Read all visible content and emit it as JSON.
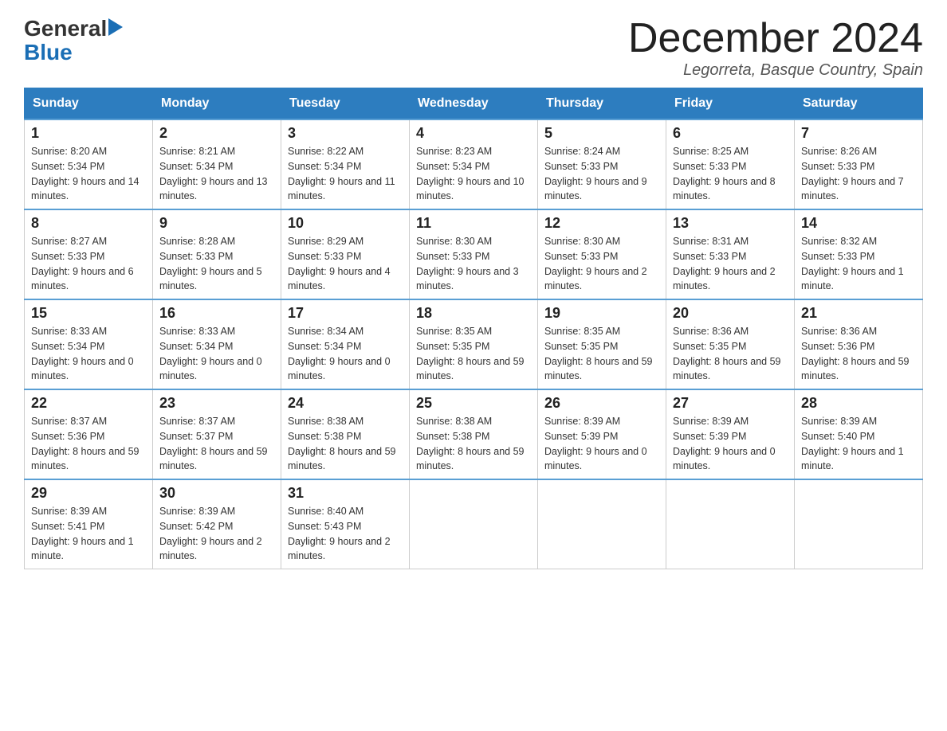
{
  "header": {
    "month_title": "December 2024",
    "location": "Legorreta, Basque Country, Spain",
    "logo_general": "General",
    "logo_blue": "Blue"
  },
  "weekdays": [
    "Sunday",
    "Monday",
    "Tuesday",
    "Wednesday",
    "Thursday",
    "Friday",
    "Saturday"
  ],
  "weeks": [
    [
      {
        "day": "1",
        "sunrise": "8:20 AM",
        "sunset": "5:34 PM",
        "daylight": "9 hours and 14 minutes."
      },
      {
        "day": "2",
        "sunrise": "8:21 AM",
        "sunset": "5:34 PM",
        "daylight": "9 hours and 13 minutes."
      },
      {
        "day": "3",
        "sunrise": "8:22 AM",
        "sunset": "5:34 PM",
        "daylight": "9 hours and 11 minutes."
      },
      {
        "day": "4",
        "sunrise": "8:23 AM",
        "sunset": "5:34 PM",
        "daylight": "9 hours and 10 minutes."
      },
      {
        "day": "5",
        "sunrise": "8:24 AM",
        "sunset": "5:33 PM",
        "daylight": "9 hours and 9 minutes."
      },
      {
        "day": "6",
        "sunrise": "8:25 AM",
        "sunset": "5:33 PM",
        "daylight": "9 hours and 8 minutes."
      },
      {
        "day": "7",
        "sunrise": "8:26 AM",
        "sunset": "5:33 PM",
        "daylight": "9 hours and 7 minutes."
      }
    ],
    [
      {
        "day": "8",
        "sunrise": "8:27 AM",
        "sunset": "5:33 PM",
        "daylight": "9 hours and 6 minutes."
      },
      {
        "day": "9",
        "sunrise": "8:28 AM",
        "sunset": "5:33 PM",
        "daylight": "9 hours and 5 minutes."
      },
      {
        "day": "10",
        "sunrise": "8:29 AM",
        "sunset": "5:33 PM",
        "daylight": "9 hours and 4 minutes."
      },
      {
        "day": "11",
        "sunrise": "8:30 AM",
        "sunset": "5:33 PM",
        "daylight": "9 hours and 3 minutes."
      },
      {
        "day": "12",
        "sunrise": "8:30 AM",
        "sunset": "5:33 PM",
        "daylight": "9 hours and 2 minutes."
      },
      {
        "day": "13",
        "sunrise": "8:31 AM",
        "sunset": "5:33 PM",
        "daylight": "9 hours and 2 minutes."
      },
      {
        "day": "14",
        "sunrise": "8:32 AM",
        "sunset": "5:33 PM",
        "daylight": "9 hours and 1 minute."
      }
    ],
    [
      {
        "day": "15",
        "sunrise": "8:33 AM",
        "sunset": "5:34 PM",
        "daylight": "9 hours and 0 minutes."
      },
      {
        "day": "16",
        "sunrise": "8:33 AM",
        "sunset": "5:34 PM",
        "daylight": "9 hours and 0 minutes."
      },
      {
        "day": "17",
        "sunrise": "8:34 AM",
        "sunset": "5:34 PM",
        "daylight": "9 hours and 0 minutes."
      },
      {
        "day": "18",
        "sunrise": "8:35 AM",
        "sunset": "5:35 PM",
        "daylight": "8 hours and 59 minutes."
      },
      {
        "day": "19",
        "sunrise": "8:35 AM",
        "sunset": "5:35 PM",
        "daylight": "8 hours and 59 minutes."
      },
      {
        "day": "20",
        "sunrise": "8:36 AM",
        "sunset": "5:35 PM",
        "daylight": "8 hours and 59 minutes."
      },
      {
        "day": "21",
        "sunrise": "8:36 AM",
        "sunset": "5:36 PM",
        "daylight": "8 hours and 59 minutes."
      }
    ],
    [
      {
        "day": "22",
        "sunrise": "8:37 AM",
        "sunset": "5:36 PM",
        "daylight": "8 hours and 59 minutes."
      },
      {
        "day": "23",
        "sunrise": "8:37 AM",
        "sunset": "5:37 PM",
        "daylight": "8 hours and 59 minutes."
      },
      {
        "day": "24",
        "sunrise": "8:38 AM",
        "sunset": "5:38 PM",
        "daylight": "8 hours and 59 minutes."
      },
      {
        "day": "25",
        "sunrise": "8:38 AM",
        "sunset": "5:38 PM",
        "daylight": "8 hours and 59 minutes."
      },
      {
        "day": "26",
        "sunrise": "8:39 AM",
        "sunset": "5:39 PM",
        "daylight": "9 hours and 0 minutes."
      },
      {
        "day": "27",
        "sunrise": "8:39 AM",
        "sunset": "5:39 PM",
        "daylight": "9 hours and 0 minutes."
      },
      {
        "day": "28",
        "sunrise": "8:39 AM",
        "sunset": "5:40 PM",
        "daylight": "9 hours and 1 minute."
      }
    ],
    [
      {
        "day": "29",
        "sunrise": "8:39 AM",
        "sunset": "5:41 PM",
        "daylight": "9 hours and 1 minute."
      },
      {
        "day": "30",
        "sunrise": "8:39 AM",
        "sunset": "5:42 PM",
        "daylight": "9 hours and 2 minutes."
      },
      {
        "day": "31",
        "sunrise": "8:40 AM",
        "sunset": "5:43 PM",
        "daylight": "9 hours and 2 minutes."
      },
      null,
      null,
      null,
      null
    ]
  ]
}
